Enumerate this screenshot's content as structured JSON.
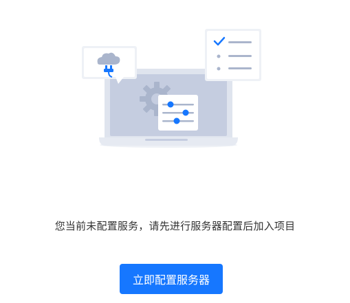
{
  "empty_state": {
    "message": "您当前未配置服务，请先进行服务器配置后加入项目",
    "action_label": "立即配置服务器",
    "illustration_icon": "server-config-illustration",
    "colors": {
      "accent": "#1677ff",
      "text": "#333333",
      "laptop_body": "#dfe4ee",
      "laptop_screen": "#c5cde0",
      "background": "#ffffff"
    }
  }
}
